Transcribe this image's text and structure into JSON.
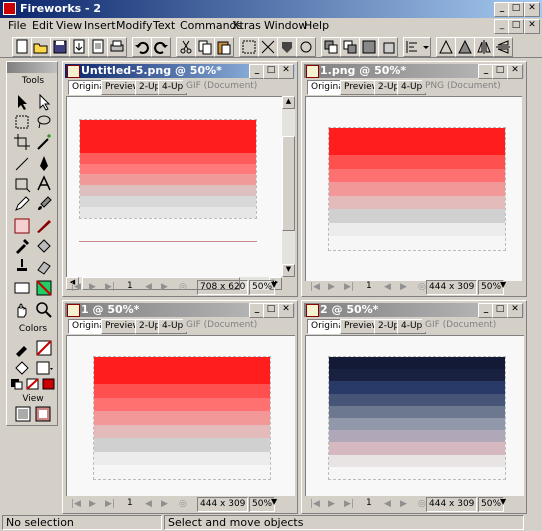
{
  "app": {
    "title": "Fireworks - 2"
  },
  "menu": [
    "File",
    "Edit",
    "View",
    "Insert",
    "Modify",
    "Text",
    "Commands",
    "Xtras",
    "Window",
    "Help"
  ],
  "tools_panel": {
    "title": "Tools",
    "sections": {
      "colors": "Colors",
      "view": "View"
    }
  },
  "windows": [
    {
      "title": "Untitled-5.png @ 50%*",
      "tabs": [
        "Original",
        "Preview",
        "2-Up",
        "4-Up",
        "GIF (Document)"
      ],
      "frame": "1",
      "size": "708 x 620",
      "zoom": "50%",
      "strips": [
        "#ff1d1d",
        "#ff1d1d",
        "#ff1d1d",
        "#ff5b5b",
        "#ff7a7a",
        "#f09a9a",
        "#dcc0c0",
        "#d8d8d8",
        "#e6e6e6"
      ]
    },
    {
      "title": "1.png @ 50%*",
      "tabs": [
        "Original",
        "Preview",
        "2-Up",
        "4-Up",
        "PNG (Document)"
      ],
      "frame": "1",
      "size": "444 x 309",
      "zoom": "50%",
      "strips": [
        "#ff1d1d",
        "#ff1d1d",
        "#ff5050",
        "#ff7070",
        "#f39898",
        "#e4bbbb",
        "#d0d0d0",
        "#ececec",
        "#f6f6f6"
      ]
    },
    {
      "title": "1 @ 50%*",
      "tabs": [
        "Original",
        "Preview",
        "2-Up",
        "4-Up",
        "GIF (Document)"
      ],
      "frame": "1",
      "size": "444 x 309",
      "zoom": "50%",
      "strips": [
        "#ff1d1d",
        "#ff1d1d",
        "#ff5050",
        "#ff7070",
        "#f39898",
        "#e4bbbb",
        "#d0d0d0",
        "#ececec",
        "#f6f6f6"
      ]
    },
    {
      "title": "2 @ 50%*",
      "tabs": [
        "Original",
        "Preview",
        "2-Up",
        "4-Up",
        "GIF (Document)"
      ],
      "frame": "1",
      "size": "444 x 309",
      "zoom": "50%",
      "strips": [
        "#121a36",
        "#182240",
        "#2a3a68",
        "#465478",
        "#6c7890",
        "#9098aa",
        "#b0a8b8",
        "#d6b8c0",
        "#e8e4e4",
        "#f6f6f6"
      ]
    }
  ],
  "statusbar": {
    "left": "No selection",
    "right": "Select and move objects"
  }
}
